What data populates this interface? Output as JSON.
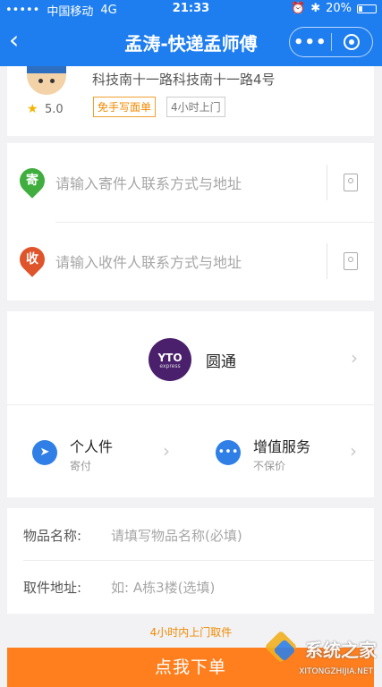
{
  "status": {
    "carrier": "中国移动",
    "network": "4G",
    "time": "21:33",
    "battery": "20%"
  },
  "nav": {
    "title": "孟涛-快递孟师傅",
    "more": "•••"
  },
  "courier": {
    "address": "科技南十一路科技南十一路4号",
    "rating": "5.0",
    "tag_free": "免手写面单",
    "tag_time": "4小时上门"
  },
  "sender": {
    "badge": "寄",
    "placeholder": "请输入寄件人联系方式与地址",
    "color": "#3fae3f"
  },
  "receiver": {
    "badge": "收",
    "placeholder": "请输入收件人联系方式与地址",
    "color": "#e0542b"
  },
  "carrier_service": {
    "name": "圆通",
    "logo": "YTO",
    "logo_sub": "express"
  },
  "options": {
    "personal": {
      "title": "个人件",
      "sub": "寄付"
    },
    "value_added": {
      "title": "增值服务",
      "sub": "不保价"
    }
  },
  "goods": {
    "name_label": "物品名称:",
    "name_placeholder": "请填写物品名称(必填)",
    "pickup_label": "取件地址:",
    "pickup_placeholder": "如: A栋3楼(选填)"
  },
  "hint": "4小时内上门取件",
  "submit": "点我下单",
  "watermark": {
    "text": "系统之家",
    "url": "XITONGZHIJIA.NET"
  },
  "colors": {
    "brand": "#1e7ef0",
    "accent": "#ff7f1e"
  }
}
